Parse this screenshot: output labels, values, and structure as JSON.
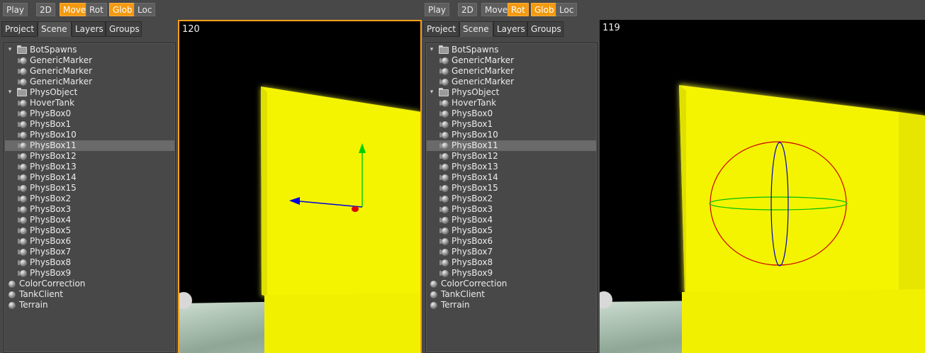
{
  "toolbar": {
    "play": "Play",
    "mode_2d": "2D",
    "move": "Move",
    "rot": "Rot",
    "glob": "Glob",
    "loc": "Loc"
  },
  "tabs": [
    "Project",
    "Scene",
    "Layers",
    "Groups"
  ],
  "active_tab": "Scene",
  "scene_tree": [
    {
      "label": "BotSpawns",
      "depth": 0,
      "kind": "folder",
      "expanded": true
    },
    {
      "label": "GenericMarker",
      "depth": 1,
      "kind": "object"
    },
    {
      "label": "GenericMarker",
      "depth": 1,
      "kind": "object"
    },
    {
      "label": "GenericMarker",
      "depth": 1,
      "kind": "object"
    },
    {
      "label": "PhysObject",
      "depth": 0,
      "kind": "folder",
      "expanded": true
    },
    {
      "label": "HoverTank",
      "depth": 1,
      "kind": "object"
    },
    {
      "label": "PhysBox0",
      "depth": 1,
      "kind": "object"
    },
    {
      "label": "PhysBox1",
      "depth": 1,
      "kind": "object"
    },
    {
      "label": "PhysBox10",
      "depth": 1,
      "kind": "object"
    },
    {
      "label": "PhysBox11",
      "depth": 1,
      "kind": "object",
      "selected": true
    },
    {
      "label": "PhysBox12",
      "depth": 1,
      "kind": "object"
    },
    {
      "label": "PhysBox13",
      "depth": 1,
      "kind": "object"
    },
    {
      "label": "PhysBox14",
      "depth": 1,
      "kind": "object"
    },
    {
      "label": "PhysBox15",
      "depth": 1,
      "kind": "object"
    },
    {
      "label": "PhysBox2",
      "depth": 1,
      "kind": "object"
    },
    {
      "label": "PhysBox3",
      "depth": 1,
      "kind": "object"
    },
    {
      "label": "PhysBox4",
      "depth": 1,
      "kind": "object"
    },
    {
      "label": "PhysBox5",
      "depth": 1,
      "kind": "object"
    },
    {
      "label": "PhysBox6",
      "depth": 1,
      "kind": "object"
    },
    {
      "label": "PhysBox7",
      "depth": 1,
      "kind": "object"
    },
    {
      "label": "PhysBox8",
      "depth": 1,
      "kind": "object"
    },
    {
      "label": "PhysBox9",
      "depth": 1,
      "kind": "object"
    },
    {
      "label": "ColorCorrection",
      "depth": 0,
      "kind": "object"
    },
    {
      "label": "TankClient",
      "depth": 0,
      "kind": "object"
    },
    {
      "label": "Terrain",
      "depth": 0,
      "kind": "object"
    }
  ],
  "panes": [
    {
      "active_tool": "Move",
      "global_active": true,
      "viewport_label": "120",
      "gizmo": "move-gizmo",
      "focused": true
    },
    {
      "active_tool": "Rot",
      "global_active": true,
      "viewport_label": "119",
      "gizmo": "rotate-gizmo",
      "focused": false
    }
  ],
  "colors": {
    "accent": "#f39a12",
    "panel": "#484848",
    "selection": "#6a6a6a",
    "box": "#f4f400",
    "axis_x": "#e00000",
    "axis_y": "#00d000",
    "axis_z": "#0000e0"
  }
}
